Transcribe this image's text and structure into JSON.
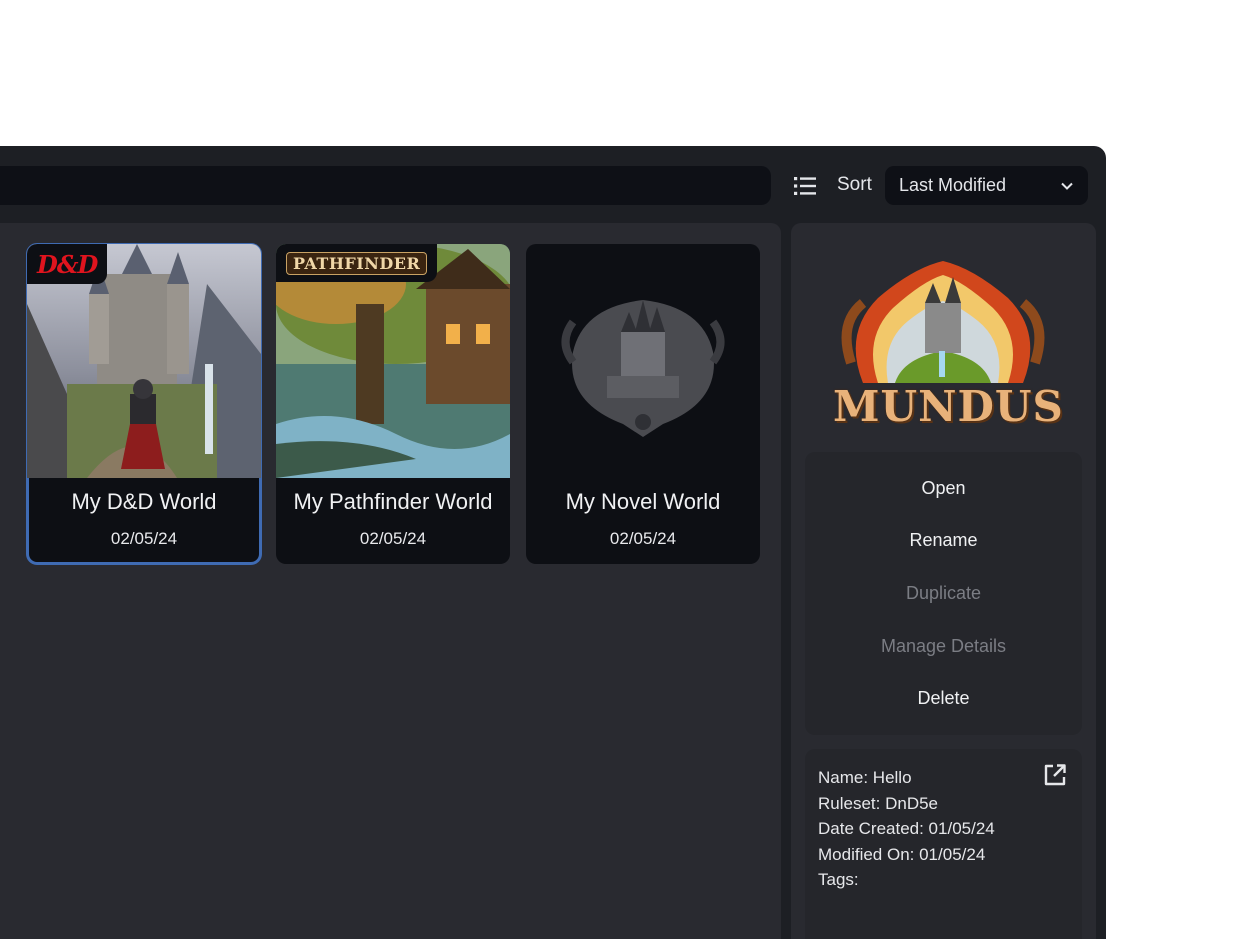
{
  "toolbar": {
    "search": {
      "value": "",
      "placeholder": ""
    },
    "view_icon": "list-icon",
    "sort_label": "Sort",
    "sort_value": "Last Modified",
    "sort_chevron_icon": "chevron-down-icon"
  },
  "worlds": [
    {
      "title": "My D&D World",
      "date": "02/05/24",
      "badge": "D&D",
      "selected": true
    },
    {
      "title": "My Pathfinder World",
      "date": "02/05/24",
      "badge": "PATHFINDER",
      "selected": false
    },
    {
      "title": "My Novel World",
      "date": "02/05/24",
      "badge": "",
      "selected": false
    }
  ],
  "side_panel": {
    "logo_text": "MUNDUS",
    "actions": [
      {
        "label": "Open",
        "enabled": true
      },
      {
        "label": "Rename",
        "enabled": true
      },
      {
        "label": "Duplicate",
        "enabled": false
      },
      {
        "label": "Manage Details",
        "enabled": false
      },
      {
        "label": "Delete",
        "enabled": true
      }
    ],
    "details": {
      "name": "Name: Hello",
      "ruleset": "Ruleset: DnD5e",
      "created": "Date Created: 01/05/24",
      "modified": "Modified On: 01/05/24",
      "tags": "Tags:"
    },
    "external_icon": "external-link-icon"
  },
  "colors": {
    "window_bg": "#1d1f24",
    "panel_bg": "#292a30",
    "card_bg": "#0d0f14",
    "selected_outline": "#3f6bb3",
    "disabled_text": "#7b7d84",
    "dnd_red": "#e0141e"
  }
}
